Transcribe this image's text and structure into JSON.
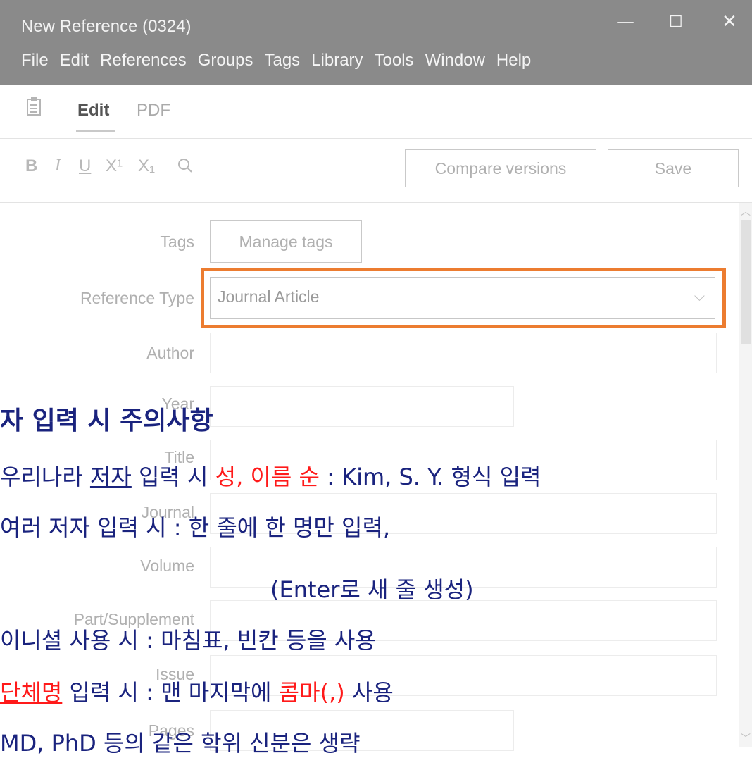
{
  "window": {
    "title": "New Reference (0324)",
    "controls": [
      "—",
      "☐",
      "✕"
    ]
  },
  "menubar": [
    "File",
    "Edit",
    "References",
    "Groups",
    "Tags",
    "Library",
    "Tools",
    "Window",
    "Help"
  ],
  "tabs": {
    "edit": "Edit",
    "pdf": "PDF"
  },
  "toolbar": {
    "bold": "B",
    "italic": "I",
    "underline": "U",
    "superscript": "X¹",
    "subscript": "X₁",
    "compare_label": "Compare versions",
    "save_label": "Save"
  },
  "form": {
    "tags_label": "Tags",
    "manage_tags": "Manage tags",
    "reference_type_label": "Reference Type",
    "reference_type_value": "Journal Article",
    "author_label": "Author",
    "year_label": "Year",
    "title_label": "Title",
    "journal_label": "Journal",
    "volume_label": "Volume",
    "part_label": "Part/Supplement",
    "issue_label": "Issue",
    "pages_label": "Pages"
  },
  "overlay": {
    "heading": "자 입력 시 주의사항",
    "line1": {
      "a": "우리나라 ",
      "b": "저자",
      "c": " 입력 시 ",
      "d": "성, 이름 순",
      "e": " : Kim, S. Y. 형식 입력"
    },
    "line2": "여러 저자 입력 시 : 한 줄에 한 명만 입력,",
    "line3": "(Enter로 새 줄 생성)",
    "line4": "이니셜 사용 시 : 마침표, 빈칸 등을 사용",
    "line5": {
      "a": "단체명",
      "b": " 입력 시 : 맨 마지막에 ",
      "c": "콤마(,)",
      "d": " 사용"
    },
    "line6": "MD, PhD 등의 같은 학위 신분은 생략"
  },
  "colors": {
    "titlebar": "#8a8a8a",
    "highlight": "#ec7c30",
    "overlay_text": "#1a237e",
    "emphasis": "#ff1a1a"
  }
}
